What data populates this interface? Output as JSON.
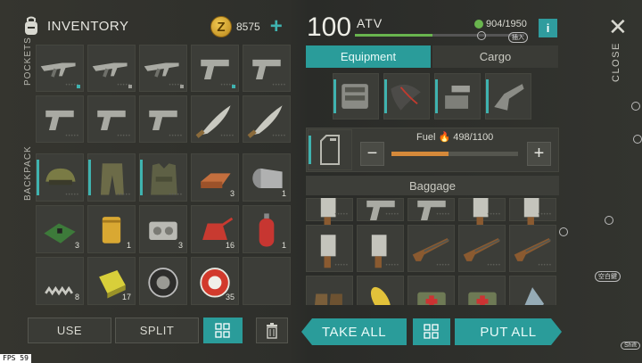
{
  "inventory": {
    "title": "INVENTORY",
    "coins": "8575",
    "coin_glyph": "Z",
    "plus": "+",
    "pockets_label": "POCKETS",
    "backpack_label": "BACKPACK",
    "pocket_slots": [
      {
        "icon": "assault-rifle-icon",
        "mark": "cyan"
      },
      {
        "icon": "assault-rifle-icon",
        "mark": "grey"
      },
      {
        "icon": "assault-rifle-icon",
        "mark": "grey"
      },
      {
        "icon": "pistol-icon",
        "mark": "cyan"
      },
      {
        "icon": "pistol-icon",
        "mark": "none"
      },
      {
        "icon": "pistol-icon",
        "mark": "none"
      },
      {
        "icon": "pistol-icon",
        "mark": "none"
      },
      {
        "icon": "pistol-icon",
        "mark": "none"
      },
      {
        "icon": "machete-icon",
        "mark": "none"
      },
      {
        "icon": "machete-icon",
        "mark": "none"
      }
    ],
    "backpack_slots": [
      {
        "icon": "helmet-icon",
        "count": ""
      },
      {
        "icon": "pants-icon",
        "count": ""
      },
      {
        "icon": "vest-icon",
        "count": ""
      },
      {
        "icon": "copper-ingot-icon",
        "count": "3"
      },
      {
        "icon": "metal-sheet-icon",
        "count": "1"
      },
      {
        "icon": "circuit-board-icon",
        "count": "3"
      },
      {
        "icon": "oil-filter-icon",
        "count": "1"
      },
      {
        "icon": "engine-part-icon",
        "count": "3"
      },
      {
        "icon": "fuel-canister-icon",
        "count": "16"
      },
      {
        "icon": "gas-cylinder-icon",
        "count": "1"
      },
      {
        "icon": "spring-icon",
        "count": "8"
      },
      {
        "icon": "battery-icon",
        "count": "17"
      },
      {
        "icon": "tire-icon",
        "count": ""
      },
      {
        "icon": "bottle-cap-icon",
        "count": "35"
      },
      {
        "icon": "empty-slot",
        "count": ""
      }
    ],
    "use_label": "USE",
    "split_label": "SPLIT"
  },
  "vehicle": {
    "level": "100",
    "name": "ATV",
    "weight": "904/1950",
    "weight_fraction": 0.46,
    "info": "i",
    "tabs": [
      "Equipment",
      "Cargo"
    ],
    "equipment": [
      "engine-block-icon",
      "wiring-icon",
      "weapon-mount-icon",
      "turret-icon"
    ],
    "fuel_label": "Fuel",
    "fuel_value": "498/1100",
    "fuel_fraction": 0.45,
    "fuel_minus": "−",
    "fuel_plus": "+",
    "baggage_label": "Baggage",
    "baggage_slots": [
      "cleaver-icon",
      "pistol-icon",
      "pistol-icon",
      "cleaver-icon",
      "cleaver-icon",
      "cleaver-icon",
      "cleaver-icon",
      "shotgun-icon",
      "shotgun-icon",
      "shotgun-icon",
      "boots-icon",
      "corn-icon",
      "medkit-icon",
      "medkit-icon",
      "glass-shard-icon"
    ],
    "take_all_label": "TAKE ALL",
    "put_all_label": "PUT ALL"
  },
  "close_label": "CLOSE",
  "close_glyph": "✕",
  "fps_label": "FPS 59",
  "hints": {
    "tag_input": "插入",
    "tag_space": "空白鍵",
    "tag_shift": "Shift"
  },
  "colors": {
    "accent": "#2a9c9a",
    "fuel": "#d5893a",
    "weight": "#69b54e",
    "coin": "#e3b33a"
  }
}
